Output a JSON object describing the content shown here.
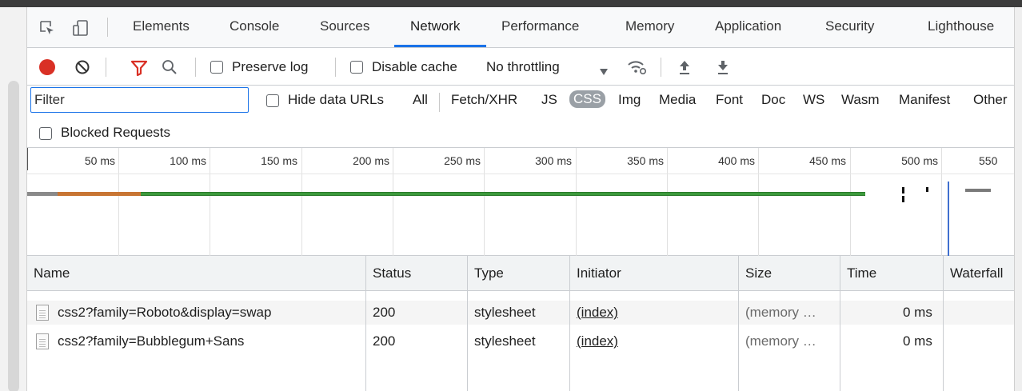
{
  "tabs": [
    {
      "label": "Elements"
    },
    {
      "label": "Console"
    },
    {
      "label": "Sources"
    },
    {
      "label": "Network"
    },
    {
      "label": "Performance"
    },
    {
      "label": "Memory"
    },
    {
      "label": "Application"
    },
    {
      "label": "Security"
    },
    {
      "label": "Lighthouse"
    }
  ],
  "active_tab": "Network",
  "toolbar": {
    "preserve_log": "Preserve log",
    "disable_cache": "Disable cache",
    "throttling": "No throttling"
  },
  "filter": {
    "placeholder": "Filter",
    "hide_data_urls": "Hide data URLs",
    "types": [
      "All",
      "Fetch/XHR",
      "JS",
      "CSS",
      "Img",
      "Media",
      "Font",
      "Doc",
      "WS",
      "Wasm",
      "Manifest",
      "Other"
    ],
    "active_type": "CSS",
    "blocked_requests": "Blocked Requests"
  },
  "overview": {
    "ticks": [
      "50 ms",
      "100 ms",
      "150 ms",
      "200 ms",
      "250 ms",
      "300 ms",
      "350 ms",
      "400 ms",
      "450 ms",
      "500 ms",
      "550"
    ]
  },
  "table": {
    "columns": [
      "Name",
      "Status",
      "Type",
      "Initiator",
      "Size",
      "Time",
      "Waterfall"
    ],
    "rows": [
      {
        "name": "css2?family=Roboto&display=swap",
        "status": "200",
        "type": "stylesheet",
        "initiator": "(index)",
        "size": "(memory …",
        "time": "0 ms"
      },
      {
        "name": "css2?family=Bubblegum+Sans",
        "status": "200",
        "type": "stylesheet",
        "initiator": "(index)",
        "size": "(memory …",
        "time": "0 ms"
      }
    ]
  },
  "colors": {
    "accent": "#1a73e8",
    "record": "#d93025",
    "filter_icon": "#d93025",
    "bar_green": "#3c9a3c",
    "bar_orange": "#c87533"
  }
}
